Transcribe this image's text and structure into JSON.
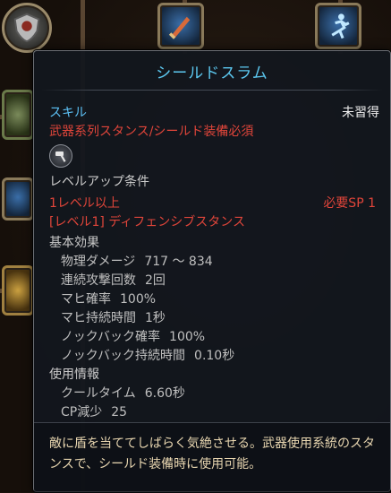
{
  "skill_tooltip": {
    "title": "シールドスラム",
    "category": "スキル",
    "learn_status": "未習得",
    "requirement": "武器系列スタンス/シールド装備必須",
    "weapon_icon": "hammer-icon",
    "levelup_header": "レベルアップ条件",
    "level_req": "1レベル以上",
    "sp_req": "必要SP 1",
    "prereq_skill": "[レベル1] ディフェンシブスタンス",
    "base_effect_header": "基本効果",
    "base_stats": [
      {
        "label": "物理ダメージ",
        "value": "717 ～ 834"
      },
      {
        "label": "連続攻撃回数",
        "value": "2回"
      },
      {
        "label": "マヒ確率",
        "value": "100%"
      },
      {
        "label": "マヒ持続時間",
        "value": "1秒"
      },
      {
        "label": "ノックバック確率",
        "value": "100%"
      },
      {
        "label": "ノックバック持続時間",
        "value": "0.10秒"
      }
    ],
    "usage_header": "使用情報",
    "usage_stats": [
      {
        "label": "クールタイム",
        "value": "6.60秒"
      },
      {
        "label": "CP減少",
        "value": "25"
      }
    ],
    "description": "敵に盾を当ててしばらく気絶させる。武器使用系統のスタンスで、シールド装備時に使用可能。"
  },
  "colors": {
    "title": "#5cc8f0",
    "category": "#5cc0f4",
    "requirement_red": "#e0453a",
    "description": "#e8d6b0"
  },
  "background_icons": [
    "shield-skill-icon",
    "sword-skill-icon",
    "dash-skill-icon",
    "stance-skill-icon",
    "green-skill-icon",
    "gold-skill-icon"
  ]
}
